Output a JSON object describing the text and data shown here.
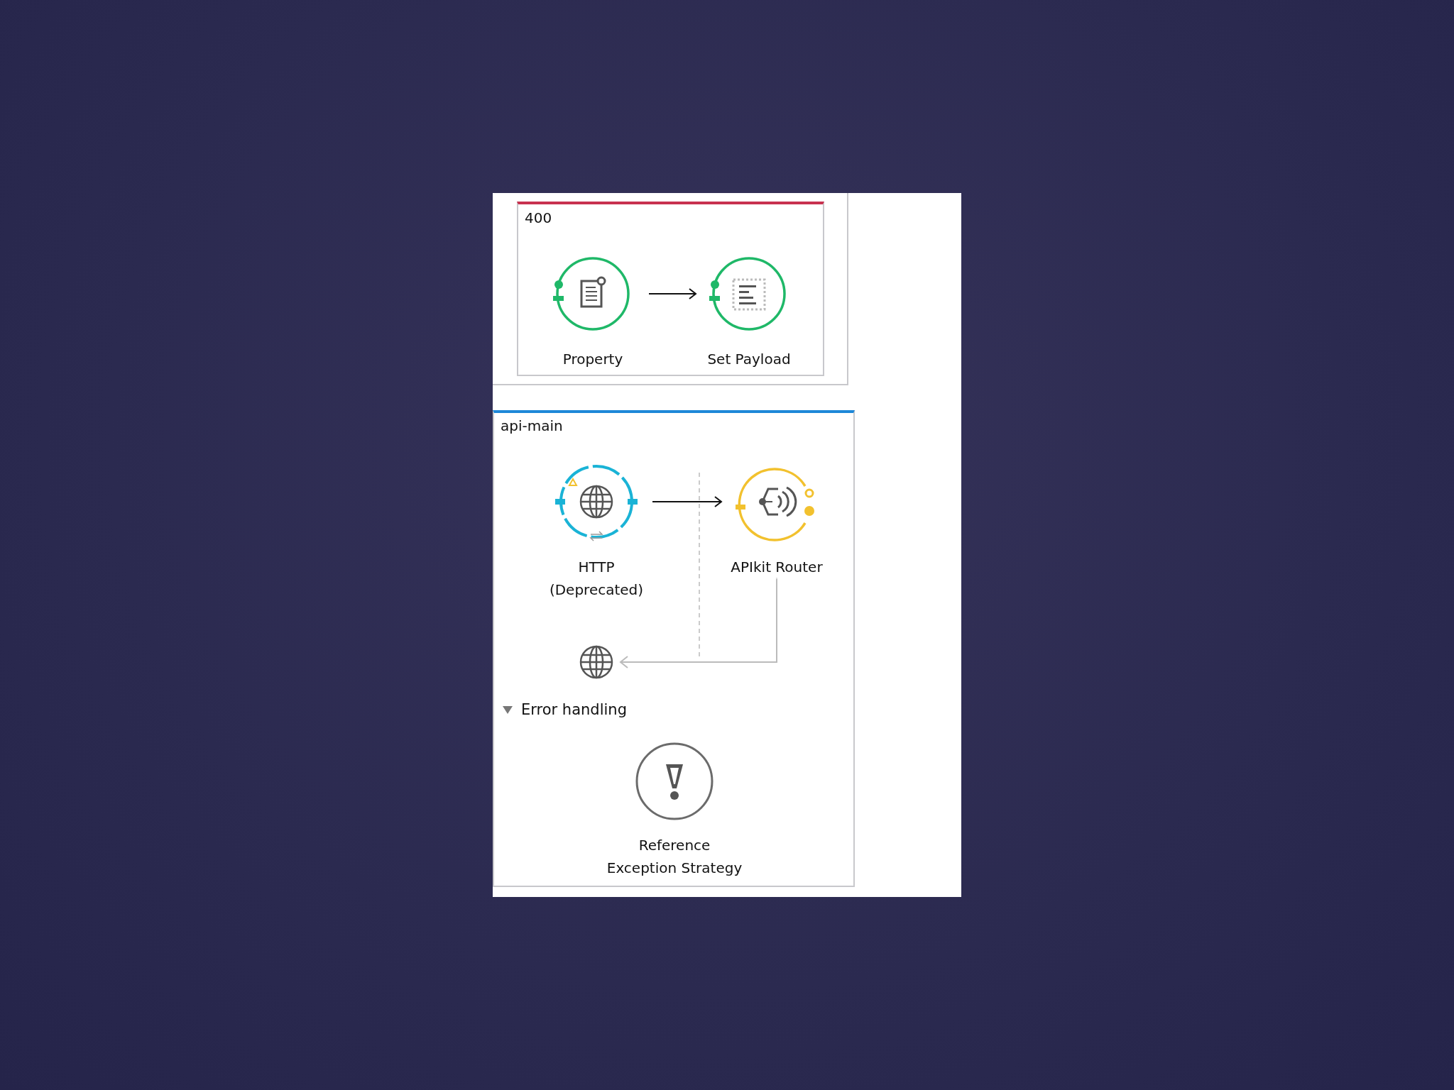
{
  "flow_400": {
    "title": "400",
    "nodes": [
      {
        "kind": "property",
        "label": "Property",
        "color": "#1fb868"
      },
      {
        "kind": "set_payload",
        "label": "Set Payload",
        "color": "#1fb868"
      }
    ]
  },
  "flow_main": {
    "title": "api-main",
    "nodes": [
      {
        "kind": "http",
        "label": "HTTP\n(Deprecated)",
        "color": "#1ab3d6"
      },
      {
        "kind": "apikit",
        "label": "APIkit Router",
        "color": "#f2c12e"
      }
    ],
    "error_handling": {
      "label": "Error handling",
      "expanded": true,
      "nodes": [
        {
          "kind": "reference",
          "label": "Reference\nException Strategy",
          "color": "#6b6b6b"
        }
      ]
    }
  }
}
